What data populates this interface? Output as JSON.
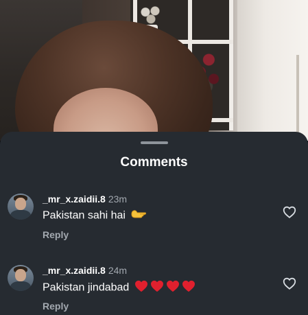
{
  "sheet": {
    "title": "Comments"
  },
  "comments": [
    {
      "username": "_mr_x.zaidii.8",
      "time": "23m",
      "text": "Pakistan sahi hai",
      "emojis": [
        "backhand-index-pointing-left"
      ],
      "reply_label": "Reply"
    },
    {
      "username": "_mr_x.zaidii.8",
      "time": "24m",
      "text": "Pakistan jindabad",
      "emojis": [
        "red-heart",
        "red-heart",
        "red-heart",
        "red-heart"
      ],
      "reply_label": "Reply"
    }
  ],
  "colors": {
    "sheet_bg": "#262b31",
    "primary_text": "#ffffff",
    "secondary_text": "#a3a9b0",
    "heart_emoji": "#e0202e"
  }
}
